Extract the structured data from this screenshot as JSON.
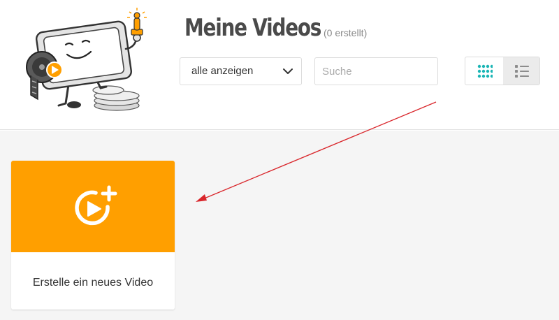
{
  "header": {
    "title": "Meine Videos",
    "count": "(0 erstellt)",
    "filter_select": {
      "selected": "alle anzeigen"
    },
    "search": {
      "placeholder": "Suche",
      "value": ""
    },
    "view_toggle": {
      "options": [
        "grid",
        "list"
      ],
      "active": "grid"
    }
  },
  "main": {
    "new_video_card": {
      "label": "Erstelle ein neues Video",
      "icon": "play-circle-plus-icon"
    }
  },
  "colors": {
    "accent_orange": "#ff9f00",
    "grid_icon_teal": "#1ab5b5",
    "arrow_red": "#d9262b",
    "title_gray": "#4a4a4a"
  }
}
